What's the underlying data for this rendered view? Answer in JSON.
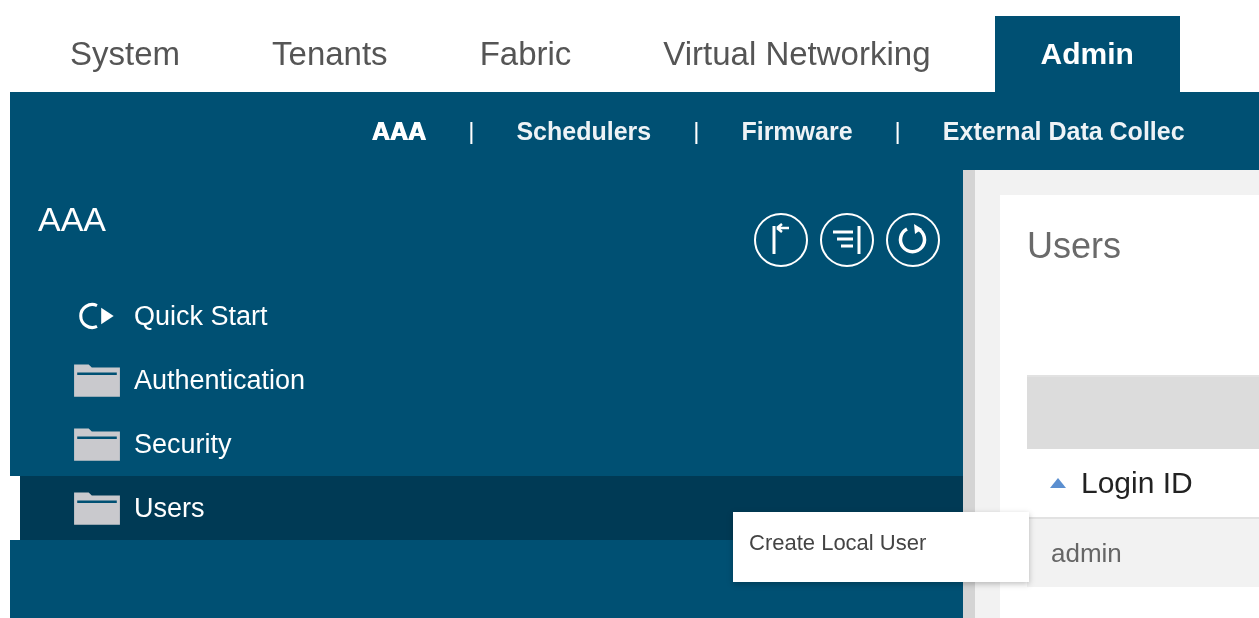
{
  "top_tabs": [
    {
      "label": "System",
      "selected": false
    },
    {
      "label": "Tenants",
      "selected": false
    },
    {
      "label": "Fabric",
      "selected": false
    },
    {
      "label": "Virtual Networking",
      "selected": false
    },
    {
      "label": "Admin",
      "selected": true
    }
  ],
  "subnav": [
    {
      "kind": "link",
      "label": "AAA",
      "selected": true
    },
    {
      "kind": "separator",
      "label": "|"
    },
    {
      "kind": "link",
      "label": "Schedulers",
      "selected": false
    },
    {
      "kind": "separator",
      "label": "|"
    },
    {
      "kind": "link",
      "label": "Firmware",
      "selected": false
    },
    {
      "kind": "separator",
      "label": "|"
    },
    {
      "kind": "link",
      "label": "External Data Collec",
      "selected": false
    }
  ],
  "sidebar": {
    "title": "AAA",
    "items": [
      {
        "kind": "quickstart",
        "label": "Quick Start",
        "selected": false
      },
      {
        "kind": "folder",
        "label": "Authentication",
        "selected": false
      },
      {
        "kind": "folder",
        "label": "Security",
        "selected": false
      },
      {
        "kind": "folder",
        "label": "Users",
        "selected": true
      }
    ]
  },
  "tooltip": "Create Local User",
  "content": {
    "title": "Users",
    "columns": [
      {
        "label": "Login ID",
        "sorted": true
      }
    ],
    "rows": [
      [
        "admin"
      ]
    ]
  }
}
